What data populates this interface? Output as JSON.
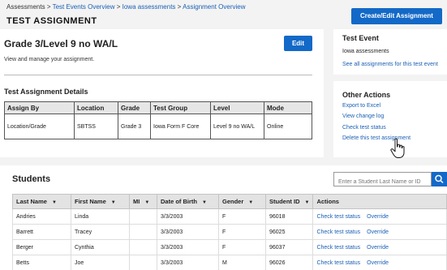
{
  "breadcrumb": {
    "root": "Assessments",
    "sep": ">",
    "item1": "Test Events Overview",
    "item2": "Iowa assessments",
    "item3": "Assignment Overview"
  },
  "page_title": "TEST ASSIGNMENT",
  "create_button": "Create/Edit Assignment",
  "assignment": {
    "title": "Grade 3/Level 9 no WA/L",
    "edit_label": "Edit",
    "subtitle": "View and manage your assignment."
  },
  "details": {
    "title": "Test Assignment Details",
    "headers": [
      "Assign By",
      "Location",
      "Grade",
      "Test Group",
      "Level",
      "Mode"
    ],
    "row": [
      "Location/Grade",
      "SBTSS",
      "Grade 3",
      "Iowa Form F Core",
      "Level 9 no WA/L",
      "Online"
    ]
  },
  "test_event": {
    "title": "Test Event",
    "name": "Iowa assessments",
    "link": "See all assignments for this test event"
  },
  "other_actions": {
    "title": "Other Actions",
    "items": [
      "Export to Excel",
      "View change log",
      "Check test status",
      "Delete this test assignment"
    ]
  },
  "students": {
    "title": "Students",
    "search_placeholder": "Enter a Student Last Name or ID",
    "columns": [
      "Last Name",
      "First Name",
      "MI",
      "Date of Birth",
      "Gender",
      "Student ID",
      "Actions"
    ],
    "rows": [
      [
        "Andries",
        "Linda",
        "",
        "3/3/2003",
        "F",
        "96018"
      ],
      [
        "Barrett",
        "Tracey",
        "",
        "3/3/2003",
        "F",
        "96025"
      ],
      [
        "Berger",
        "Cynthia",
        "",
        "3/3/2003",
        "F",
        "96037"
      ],
      [
        "Betts",
        "Joe",
        "",
        "3/3/2003",
        "M",
        "96026"
      ]
    ],
    "action_check": "Check test status",
    "action_override": "Override"
  },
  "icons": {
    "sort": "caret-down-icon",
    "search": "search-icon",
    "cursor": "hand-pointer-icon"
  },
  "colors": {
    "primary": "#1369c7",
    "link": "#1a5fb4",
    "background": "#f3f3f3"
  }
}
